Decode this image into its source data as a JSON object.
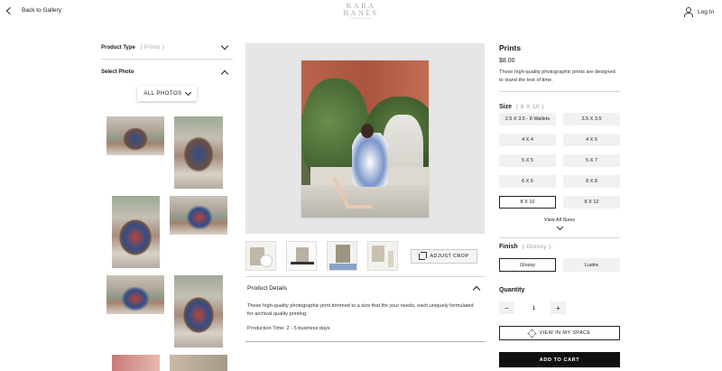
{
  "header": {
    "back_label": "Back to Gallery",
    "logo_line1": "KARA",
    "logo_line2": "HANES",
    "logo_line3": "PHOTOGRAPHY",
    "login_label": "Log In"
  },
  "left": {
    "product_type_label": "Product Type",
    "product_type_value": "( Prints )",
    "select_photo_label": "Select Photo",
    "all_photos_label": "ALL PHOTOS"
  },
  "preview": {
    "adjust_crop_label": "ADJUST CROP"
  },
  "details": {
    "heading": "Product Details",
    "description": "These high-quality photographic print trimmed to a size that fits your needs, each uniquely formulated for archival quality printing.",
    "production_time": "Production Time: 2 - 5 business days"
  },
  "product": {
    "title": "Prints",
    "price": "$8.00",
    "description": "These high-quality photographic prints are designed to stand the test of time.",
    "size_label": "Size",
    "size_value": "( 8 X 10 )",
    "sizes": [
      "2.5 X 3.5 - 8 Wallets",
      "3.5 X 3.5",
      "4 X 4",
      "4 X 6",
      "5 X 5",
      "5 X 7",
      "6 X 6",
      "8 X 8",
      "8 X 10",
      "8 X 12"
    ],
    "selected_size": "8 X 10",
    "view_all_sizes": "View All Sizes",
    "finish_label": "Finish",
    "finish_value": "( Glossy )",
    "finishes": [
      "Glossy",
      "Lustre"
    ],
    "quantity_label": "Quantity",
    "quantity": "1",
    "minus": "−",
    "plus": "+",
    "view_in_space": "VIEW IN MY SPACE",
    "add_to_cart": "ADD TO CART"
  }
}
